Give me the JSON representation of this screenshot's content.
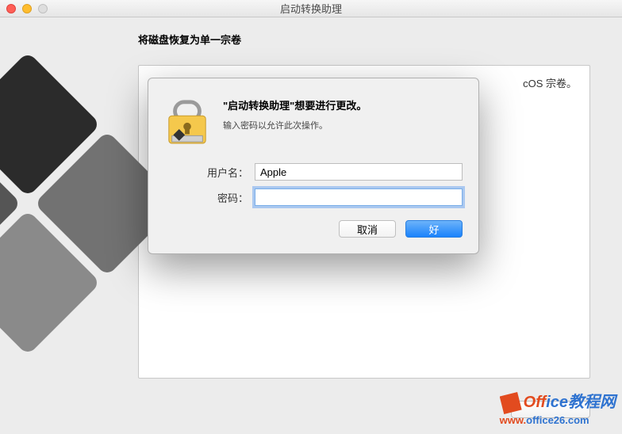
{
  "titlebar": {
    "title": "启动转换助理"
  },
  "main": {
    "heading": "将磁盘恢复为单一宗卷",
    "panel_right_text": "cOS 宗卷。"
  },
  "auth": {
    "title": "\"启动转换助理\"想要进行更改。",
    "subtitle": "输入密码以允许此次操作。",
    "username_label": "用户名：",
    "username_value": "Apple",
    "password_label": "密码：",
    "password_value": "",
    "cancel": "取消",
    "ok": "好"
  },
  "watermark": {
    "part1": "Off",
    "part2": "ice教程网",
    "url_part1": "www.",
    "url_part2": "office26.com"
  }
}
